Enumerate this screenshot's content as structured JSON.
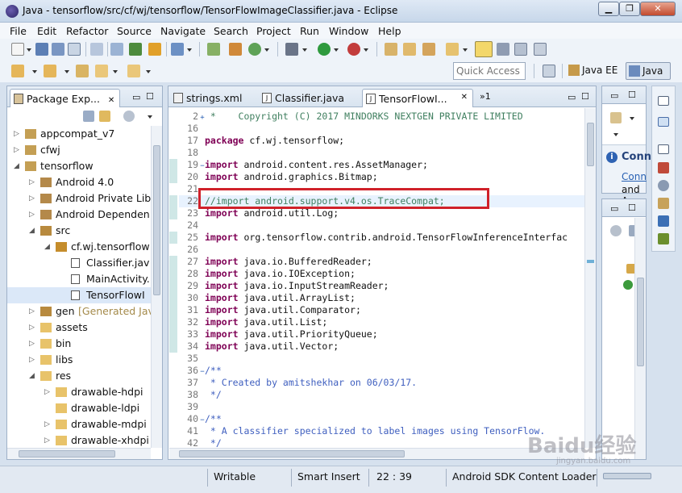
{
  "window": {
    "title": "Java - tensorflow/src/cf/wj/tensorflow/TensorFlowImageClassifier.java - Eclipse"
  },
  "menu": [
    "File",
    "Edit",
    "Refactor",
    "Source",
    "Navigate",
    "Search",
    "Project",
    "Run",
    "Window",
    "Help"
  ],
  "toolbar": {
    "quick_access_placeholder": "Quick Access",
    "perspectives": [
      "Java EE",
      "Java"
    ]
  },
  "package_explorer": {
    "tab_label": "Package Exp...",
    "items": [
      {
        "label": "appcompat_v7",
        "depth": 0,
        "expanded": false,
        "kind": "project"
      },
      {
        "label": "cfwj",
        "depth": 0,
        "expanded": false,
        "kind": "project"
      },
      {
        "label": "tensorflow",
        "depth": 0,
        "expanded": true,
        "kind": "project"
      },
      {
        "label": "Android 4.0",
        "depth": 1,
        "expanded": false,
        "kind": "library"
      },
      {
        "label": "Android Private Lib",
        "depth": 1,
        "expanded": false,
        "kind": "library"
      },
      {
        "label": "Android Dependen",
        "depth": 1,
        "expanded": false,
        "kind": "library"
      },
      {
        "label": "src",
        "depth": 1,
        "expanded": true,
        "kind": "srcfolder"
      },
      {
        "label": "cf.wj.tensorflow",
        "depth": 2,
        "expanded": true,
        "kind": "package"
      },
      {
        "label": "Classifier.jav",
        "depth": 3,
        "expanded": false,
        "kind": "javafile"
      },
      {
        "label": "MainActivity.",
        "depth": 3,
        "expanded": false,
        "kind": "javafile"
      },
      {
        "label": "TensorFlowI",
        "depth": 3,
        "expanded": false,
        "kind": "javafile",
        "selected": true
      },
      {
        "label": "gen",
        "suffix": "[Generated Jav",
        "depth": 1,
        "expanded": false,
        "kind": "srcfolder"
      },
      {
        "label": "assets",
        "depth": 1,
        "expanded": false,
        "kind": "folder"
      },
      {
        "label": "bin",
        "depth": 1,
        "expanded": false,
        "kind": "folder"
      },
      {
        "label": "libs",
        "depth": 1,
        "expanded": false,
        "kind": "folder"
      },
      {
        "label": "res",
        "depth": 1,
        "expanded": true,
        "kind": "folder"
      },
      {
        "label": "drawable-hdpi",
        "depth": 2,
        "expanded": false,
        "kind": "folder"
      },
      {
        "label": "drawable-ldpi",
        "depth": 2,
        "expanded": false,
        "kind": "folder",
        "leaf": true
      },
      {
        "label": "drawable-mdpi",
        "depth": 2,
        "expanded": false,
        "kind": "folder"
      },
      {
        "label": "drawable-xhdpi",
        "depth": 2,
        "expanded": false,
        "kind": "folder"
      }
    ]
  },
  "editor": {
    "tabs": [
      {
        "label": "strings.xml",
        "active": false
      },
      {
        "label": "Classifier.java",
        "active": false
      },
      {
        "label": "TensorFlowI...",
        "active": true
      }
    ],
    "overflow_count": "»1",
    "lines": [
      {
        "n": "2",
        "fold": "+",
        "text": " *    Copyright (C) 2017 MINDORKS NEXTGEN PRIVATE LIMITED",
        "style": "cm"
      },
      {
        "n": "16",
        "fold": "",
        "text": "",
        "style": ""
      },
      {
        "n": "17",
        "fold": "",
        "text": "package cf.wj.tensorflow;",
        "style": "pkg"
      },
      {
        "n": "18",
        "fold": "",
        "text": "",
        "style": ""
      },
      {
        "n": "19",
        "fold": "−",
        "text": "import android.content.res.AssetManager;",
        "style": "imp"
      },
      {
        "n": "20",
        "fold": "",
        "text": "import android.graphics.Bitmap;",
        "style": "imp"
      },
      {
        "n": "21",
        "fold": "",
        "text": "",
        "style": ""
      },
      {
        "n": "22",
        "fold": "",
        "text": "//import android.support.v4.os.TraceCompat;",
        "style": "cm",
        "highlight": true
      },
      {
        "n": "23",
        "fold": "",
        "text": "import android.util.Log;",
        "style": "imp"
      },
      {
        "n": "24",
        "fold": "",
        "text": "",
        "style": ""
      },
      {
        "n": "25",
        "fold": "",
        "text": "import org.tensorflow.contrib.android.TensorFlowInferenceInterfac",
        "style": "imp"
      },
      {
        "n": "26",
        "fold": "",
        "text": "",
        "style": ""
      },
      {
        "n": "27",
        "fold": "",
        "text": "import java.io.BufferedReader;",
        "style": "imp"
      },
      {
        "n": "28",
        "fold": "",
        "text": "import java.io.IOException;",
        "style": "imp"
      },
      {
        "n": "29",
        "fold": "",
        "text": "import java.io.InputStreamReader;",
        "style": "imp"
      },
      {
        "n": "30",
        "fold": "",
        "text": "import java.util.ArrayList;",
        "style": "imp"
      },
      {
        "n": "31",
        "fold": "",
        "text": "import java.util.Comparator;",
        "style": "imp"
      },
      {
        "n": "32",
        "fold": "",
        "text": "import java.util.List;",
        "style": "imp"
      },
      {
        "n": "33",
        "fold": "",
        "text": "import java.util.PriorityQueue;",
        "style": "imp"
      },
      {
        "n": "34",
        "fold": "",
        "text": "import java.util.Vector;",
        "style": "imp"
      },
      {
        "n": "35",
        "fold": "",
        "text": "",
        "style": ""
      },
      {
        "n": "36",
        "fold": "−",
        "text": "/**",
        "style": "dc"
      },
      {
        "n": "37",
        "fold": "",
        "text": " * Created by amitshekhar on 06/03/17.",
        "style": "dc"
      },
      {
        "n": "38",
        "fold": "",
        "text": " */",
        "style": "dc"
      },
      {
        "n": "39",
        "fold": "",
        "text": "",
        "style": ""
      },
      {
        "n": "40",
        "fold": "−",
        "text": "/**",
        "style": "dc"
      },
      {
        "n": "41",
        "fold": "",
        "text": " * A classifier specialized to label images using TensorFlow.",
        "style": "dc"
      },
      {
        "n": "42",
        "fold": "",
        "text": " */",
        "style": "dc"
      }
    ]
  },
  "right_panel": {
    "heading": "Conn",
    "link": "Conn",
    "text": "and A"
  },
  "statusbar": {
    "writable": "Writable",
    "insert_mode": "Smart Insert",
    "position": "22 : 39",
    "task": "Android SDK Content Loader"
  },
  "watermark": {
    "text": "Baidu经验",
    "sub": "jingyan.baidu.com"
  },
  "colors": {
    "highlight_box": "#d0212a",
    "selected_row": "#dbe8f8"
  }
}
